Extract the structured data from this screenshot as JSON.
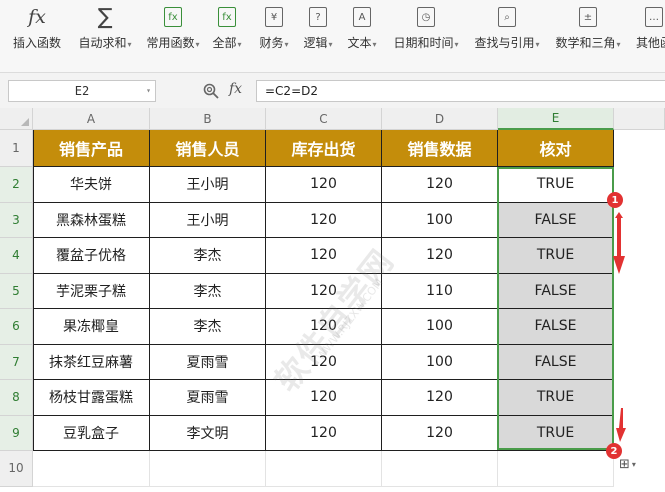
{
  "ribbon": {
    "items": [
      {
        "label": "插入函数",
        "icon": "fx-icon"
      },
      {
        "label": "自动求和",
        "icon": "sigma-icon"
      },
      {
        "label": "常用函数",
        "icon": "common-function-icon"
      },
      {
        "label": "全部",
        "icon": "all-functions-icon"
      },
      {
        "label": "财务",
        "icon": "finance-icon"
      },
      {
        "label": "逻辑",
        "icon": "logic-icon"
      },
      {
        "label": "文本",
        "icon": "text-icon"
      },
      {
        "label": "日期和时间",
        "icon": "clock-icon"
      },
      {
        "label": "查找与引用",
        "icon": "lookup-icon"
      },
      {
        "label": "数学和三角",
        "icon": "math-icon"
      },
      {
        "label": "其他函",
        "icon": "other-icon"
      }
    ]
  },
  "formula_bar": {
    "name_box": "E2",
    "fx_label": "fx",
    "formula": "=C2=D2"
  },
  "sheet": {
    "columns": [
      "A",
      "B",
      "C",
      "D",
      "E"
    ],
    "rows": [
      "1",
      "2",
      "3",
      "4",
      "5",
      "6",
      "7",
      "8",
      "9",
      "10"
    ],
    "headers": [
      "销售产品",
      "销售人员",
      "库存出货",
      "销售数据",
      "核对"
    ],
    "data": [
      [
        "华夫饼",
        "王小明",
        "120",
        "120",
        "TRUE"
      ],
      [
        "黑森林蛋糕",
        "王小明",
        "120",
        "100",
        "FALSE"
      ],
      [
        "覆盆子优格",
        "李杰",
        "120",
        "120",
        "TRUE"
      ],
      [
        "芋泥栗子糕",
        "李杰",
        "120",
        "110",
        "FALSE"
      ],
      [
        "果冻椰皇",
        "李杰",
        "120",
        "100",
        "FALSE"
      ],
      [
        "抹茶红豆麻薯",
        "夏雨雪",
        "120",
        "100",
        "FALSE"
      ],
      [
        "杨枝甘露蛋糕",
        "夏雨雪",
        "120",
        "120",
        "TRUE"
      ],
      [
        "豆乳盒子",
        "李文明",
        "120",
        "120",
        "TRUE"
      ]
    ]
  },
  "annotations": {
    "callout1": "1",
    "callout2": "2"
  },
  "colors": {
    "header_fill": "#c48d0b",
    "selection": "#4a9c4a",
    "callout": "#e23232",
    "gray_fill": "#d9d9d9"
  }
}
